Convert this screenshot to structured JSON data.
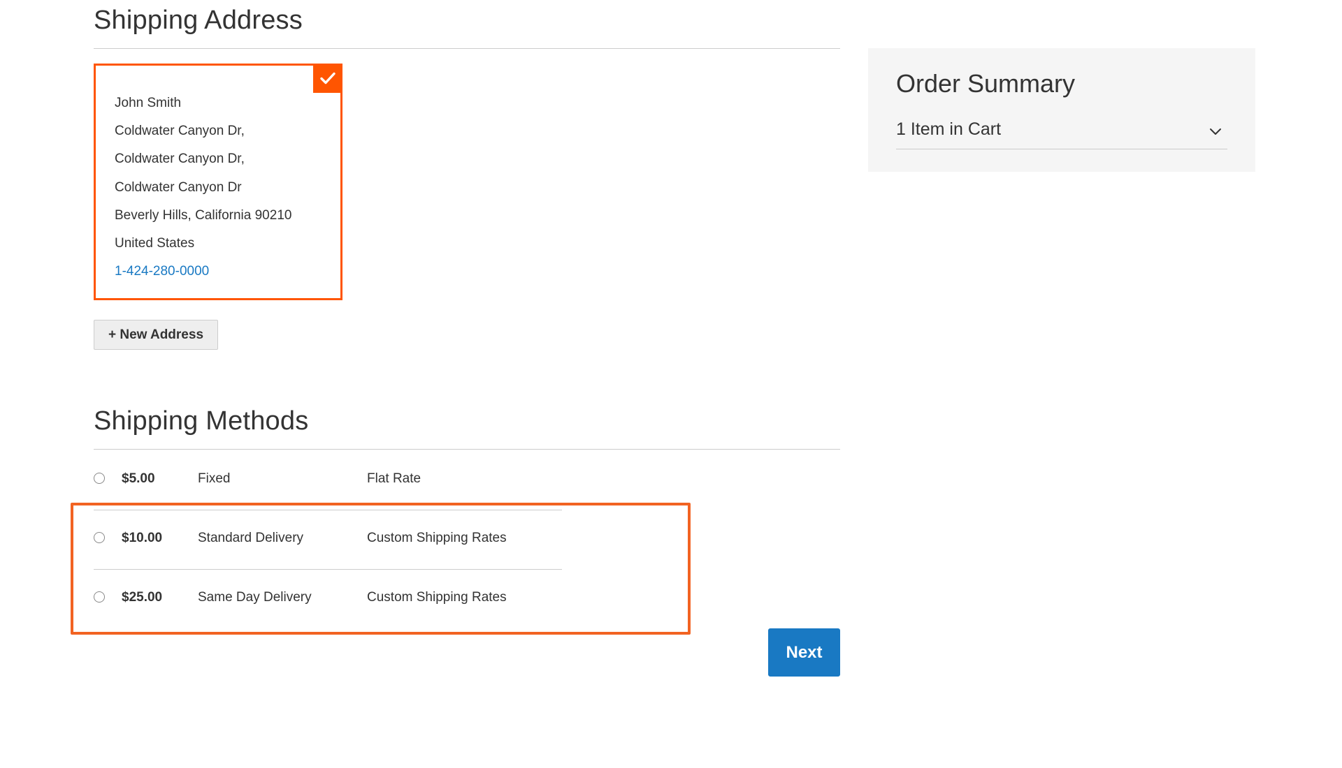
{
  "shipping_address": {
    "title": "Shipping Address",
    "selected_card": {
      "lines": [
        "John Smith",
        "Coldwater Canyon Dr,",
        "Coldwater Canyon Dr,",
        "Coldwater Canyon Dr",
        "Beverly Hills, California 90210",
        "United States"
      ],
      "phone": "1-424-280-0000",
      "selected_icon": "checkmark-icon",
      "accent_color": "#ff5501"
    },
    "new_address_label": "+ New Address"
  },
  "shipping_methods": {
    "title": "Shipping Methods",
    "rows": [
      {
        "price": "$5.00",
        "method": "Fixed",
        "carrier": "Flat Rate",
        "selected": false
      },
      {
        "price": "$10.00",
        "method": "Standard Delivery",
        "carrier": "Custom Shipping Rates",
        "selected": false
      },
      {
        "price": "$25.00",
        "method": "Same Day Delivery",
        "carrier": "Custom Shipping Rates",
        "selected": false
      }
    ],
    "highlight_color": "#f26322"
  },
  "next_button": {
    "label": "Next",
    "color": "#1979c3"
  },
  "order_summary": {
    "title": "Order Summary",
    "cart_label": "1 Item in Cart",
    "toggle_icon": "chevron-down-icon"
  }
}
